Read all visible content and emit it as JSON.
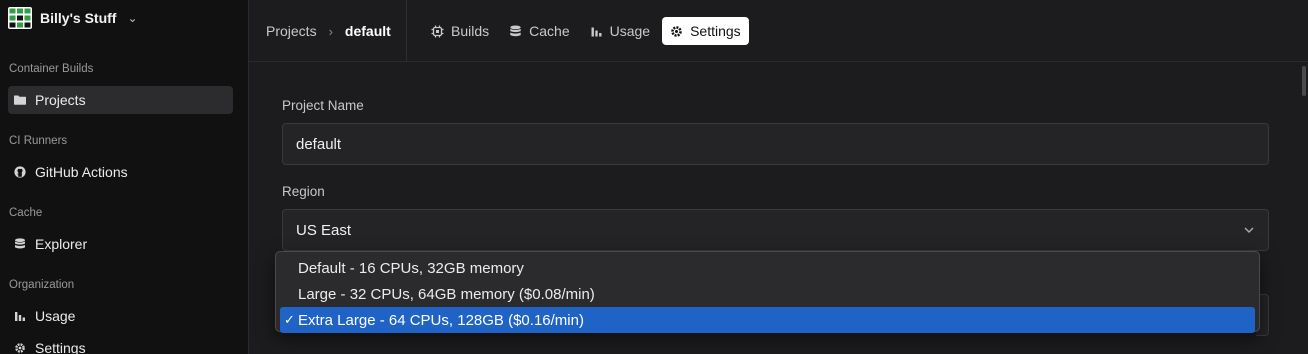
{
  "org": {
    "name": "Billy's Stuff",
    "logo_icon": "grid-logo-icon",
    "menu_icon": "chevron-down-icon"
  },
  "sidebar": {
    "sections": [
      {
        "label": "Container Builds",
        "items": [
          {
            "label": "Projects",
            "icon": "folder-icon",
            "active": true
          }
        ]
      },
      {
        "label": "CI Runners",
        "items": [
          {
            "label": "GitHub Actions",
            "icon": "github-icon",
            "active": false
          }
        ]
      },
      {
        "label": "Cache",
        "items": [
          {
            "label": "Explorer",
            "icon": "database-icon",
            "active": false
          }
        ]
      },
      {
        "label": "Organization",
        "items": [
          {
            "label": "Usage",
            "icon": "bar-chart-icon",
            "active": false
          },
          {
            "label": "Settings",
            "icon": "gear-icon",
            "active": false
          }
        ]
      }
    ]
  },
  "breadcrumb": {
    "parent": "Projects",
    "current": "default",
    "separator": "›"
  },
  "tabs": [
    {
      "label": "Builds",
      "icon": "cpu-icon",
      "active": false
    },
    {
      "label": "Cache",
      "icon": "database-icon",
      "active": false
    },
    {
      "label": "Usage",
      "icon": "bar-chart-icon",
      "active": false
    },
    {
      "label": "Settings",
      "icon": "gear-icon",
      "active": true
    }
  ],
  "form": {
    "project_name_label": "Project Name",
    "project_name_value": "default",
    "region_label": "Region",
    "region_value": "US East"
  },
  "dropdown": {
    "options": [
      {
        "label": "Default - 16 CPUs, 32GB memory",
        "selected": false
      },
      {
        "label": "Large - 32 CPUs, 64GB memory ($0.08/min)",
        "selected": false
      },
      {
        "label": "Extra Large - 64 CPUs, 128GB ($0.16/min)",
        "selected": true
      }
    ],
    "check_glyph": "✓"
  },
  "colors": {
    "accent_selected": "#1f63c7",
    "active_tab_bg": "#ffffff",
    "sidebar_bg": "#111112",
    "main_bg": "#1c1c1e"
  }
}
